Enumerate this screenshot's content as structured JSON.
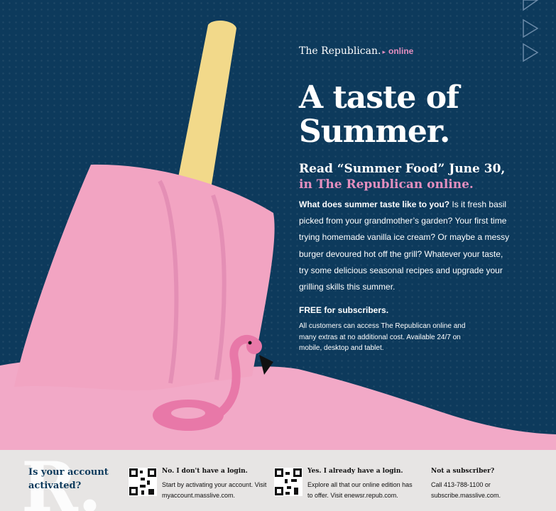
{
  "masthead": {
    "brand": "The Republican.",
    "arrow": "▸",
    "suffix": "online"
  },
  "headline": {
    "line1": "A taste of",
    "line2": "Summer."
  },
  "subhead": {
    "line1": "Read “Summer Food” June 30,",
    "line2": "in The Republican online."
  },
  "body": {
    "lead": "What does summer taste like to you?",
    "text": " Is it fresh basil picked from your grandmother’s garden? Your first time trying homemade vanilla ice cream? Or maybe a messy burger devoured hot off the grill? Whatever your taste, try some delicious seasonal recipes and upgrade your grilling skills this summer."
  },
  "free": "FREE for subscribers.",
  "small": "All customers can access The Republican online and many extras at no additional cost. Available 24/7 on mobile, desktop and tablet.",
  "footer": {
    "big_letter": "R.",
    "ask": "Is your account activated?",
    "col1": {
      "heading": "No. I don't have a login.",
      "text": "Start by activating your account. Visit myaccount.masslive.com."
    },
    "col2": {
      "heading": "Yes. I already have a login.",
      "text": "Explore all that our online edition has to offer. Visit enewsr.repub.com."
    },
    "col3": {
      "heading": "Not a subscriber?",
      "text": "Call 413-788-1100 or subscribe.masslive.com."
    }
  },
  "colors": {
    "navy": "#0d3a5c",
    "pink": "#e48fbf",
    "popsicle": "#f2a4c2",
    "stick": "#f2d98a"
  },
  "icons": [
    "popsicle-illustration",
    "flamingo-float-icon",
    "triangle-outline-icon",
    "qr-code-icon"
  ]
}
